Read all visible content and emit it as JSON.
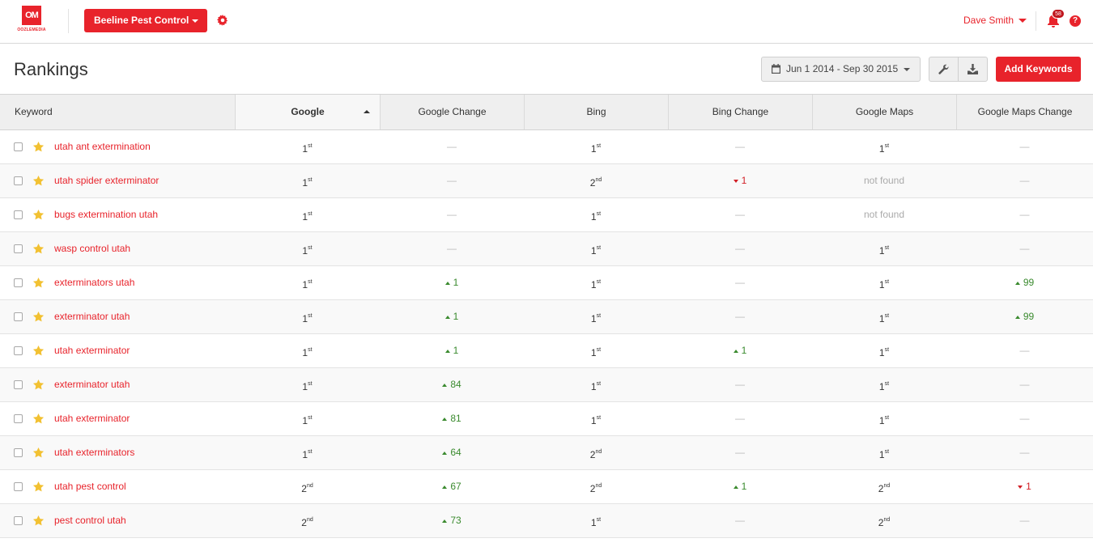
{
  "brand": {
    "logo_mark": "OM",
    "logo_text": "OOZLEMEDIA",
    "accent_color": "#e8232b"
  },
  "header": {
    "client_selector": "Beeline Pest Control",
    "user_name": "Dave Smith",
    "notification_count": "58"
  },
  "page": {
    "title": "Rankings",
    "date_range": "Jun 1 2014 - Sep 30 2015",
    "add_keywords_label": "Add Keywords"
  },
  "table": {
    "columns": [
      "Keyword",
      "Google",
      "Google Change",
      "Bing",
      "Bing Change",
      "Google Maps",
      "Google Maps Change"
    ],
    "sorted_column": "Google",
    "rows": [
      {
        "keyword": "utah ant extermination",
        "google": [
          "1",
          "st"
        ],
        "google_change": {
          "dir": "none",
          "value": "—"
        },
        "bing": [
          "1",
          "st"
        ],
        "bing_change": {
          "dir": "none",
          "value": "—"
        },
        "maps": [
          "1",
          "st"
        ],
        "maps_change": {
          "dir": "none",
          "value": "—"
        }
      },
      {
        "keyword": "utah spider exterminator",
        "google": [
          "1",
          "st"
        ],
        "google_change": {
          "dir": "none",
          "value": "—"
        },
        "bing": [
          "2",
          "nd"
        ],
        "bing_change": {
          "dir": "down",
          "value": "1"
        },
        "maps": "not found",
        "maps_change": {
          "dir": "none",
          "value": "—"
        }
      },
      {
        "keyword": "bugs extermination utah",
        "google": [
          "1",
          "st"
        ],
        "google_change": {
          "dir": "none",
          "value": "—"
        },
        "bing": [
          "1",
          "st"
        ],
        "bing_change": {
          "dir": "none",
          "value": "—"
        },
        "maps": "not found",
        "maps_change": {
          "dir": "none",
          "value": "—"
        }
      },
      {
        "keyword": "wasp control utah",
        "google": [
          "1",
          "st"
        ],
        "google_change": {
          "dir": "none",
          "value": "—"
        },
        "bing": [
          "1",
          "st"
        ],
        "bing_change": {
          "dir": "none",
          "value": "—"
        },
        "maps": [
          "1",
          "st"
        ],
        "maps_change": {
          "dir": "none",
          "value": "—"
        }
      },
      {
        "keyword": "exterminators utah",
        "google": [
          "1",
          "st"
        ],
        "google_change": {
          "dir": "up",
          "value": "1"
        },
        "bing": [
          "1",
          "st"
        ],
        "bing_change": {
          "dir": "none",
          "value": "—"
        },
        "maps": [
          "1",
          "st"
        ],
        "maps_change": {
          "dir": "up",
          "value": "99"
        }
      },
      {
        "keyword": "exterminator utah",
        "google": [
          "1",
          "st"
        ],
        "google_change": {
          "dir": "up",
          "value": "1"
        },
        "bing": [
          "1",
          "st"
        ],
        "bing_change": {
          "dir": "none",
          "value": "—"
        },
        "maps": [
          "1",
          "st"
        ],
        "maps_change": {
          "dir": "up",
          "value": "99"
        }
      },
      {
        "keyword": "utah exterminator",
        "google": [
          "1",
          "st"
        ],
        "google_change": {
          "dir": "up",
          "value": "1"
        },
        "bing": [
          "1",
          "st"
        ],
        "bing_change": {
          "dir": "up",
          "value": "1"
        },
        "maps": [
          "1",
          "st"
        ],
        "maps_change": {
          "dir": "none",
          "value": "—"
        }
      },
      {
        "keyword": "exterminator utah",
        "google": [
          "1",
          "st"
        ],
        "google_change": {
          "dir": "up",
          "value": "84"
        },
        "bing": [
          "1",
          "st"
        ],
        "bing_change": {
          "dir": "none",
          "value": "—"
        },
        "maps": [
          "1",
          "st"
        ],
        "maps_change": {
          "dir": "none",
          "value": "—"
        }
      },
      {
        "keyword": "utah exterminator",
        "google": [
          "1",
          "st"
        ],
        "google_change": {
          "dir": "up",
          "value": "81"
        },
        "bing": [
          "1",
          "st"
        ],
        "bing_change": {
          "dir": "none",
          "value": "—"
        },
        "maps": [
          "1",
          "st"
        ],
        "maps_change": {
          "dir": "none",
          "value": "—"
        }
      },
      {
        "keyword": "utah exterminators",
        "google": [
          "1",
          "st"
        ],
        "google_change": {
          "dir": "up",
          "value": "64"
        },
        "bing": [
          "2",
          "nd"
        ],
        "bing_change": {
          "dir": "none",
          "value": "—"
        },
        "maps": [
          "1",
          "st"
        ],
        "maps_change": {
          "dir": "none",
          "value": "—"
        }
      },
      {
        "keyword": "utah pest control",
        "google": [
          "2",
          "nd"
        ],
        "google_change": {
          "dir": "up",
          "value": "67"
        },
        "bing": [
          "2",
          "nd"
        ],
        "bing_change": {
          "dir": "up",
          "value": "1"
        },
        "maps": [
          "2",
          "nd"
        ],
        "maps_change": {
          "dir": "down",
          "value": "1"
        }
      },
      {
        "keyword": "pest control utah",
        "google": [
          "2",
          "nd"
        ],
        "google_change": {
          "dir": "up",
          "value": "73"
        },
        "bing": [
          "1",
          "st"
        ],
        "bing_change": {
          "dir": "none",
          "value": "—"
        },
        "maps": [
          "2",
          "nd"
        ],
        "maps_change": {
          "dir": "none",
          "value": "—"
        }
      }
    ]
  }
}
